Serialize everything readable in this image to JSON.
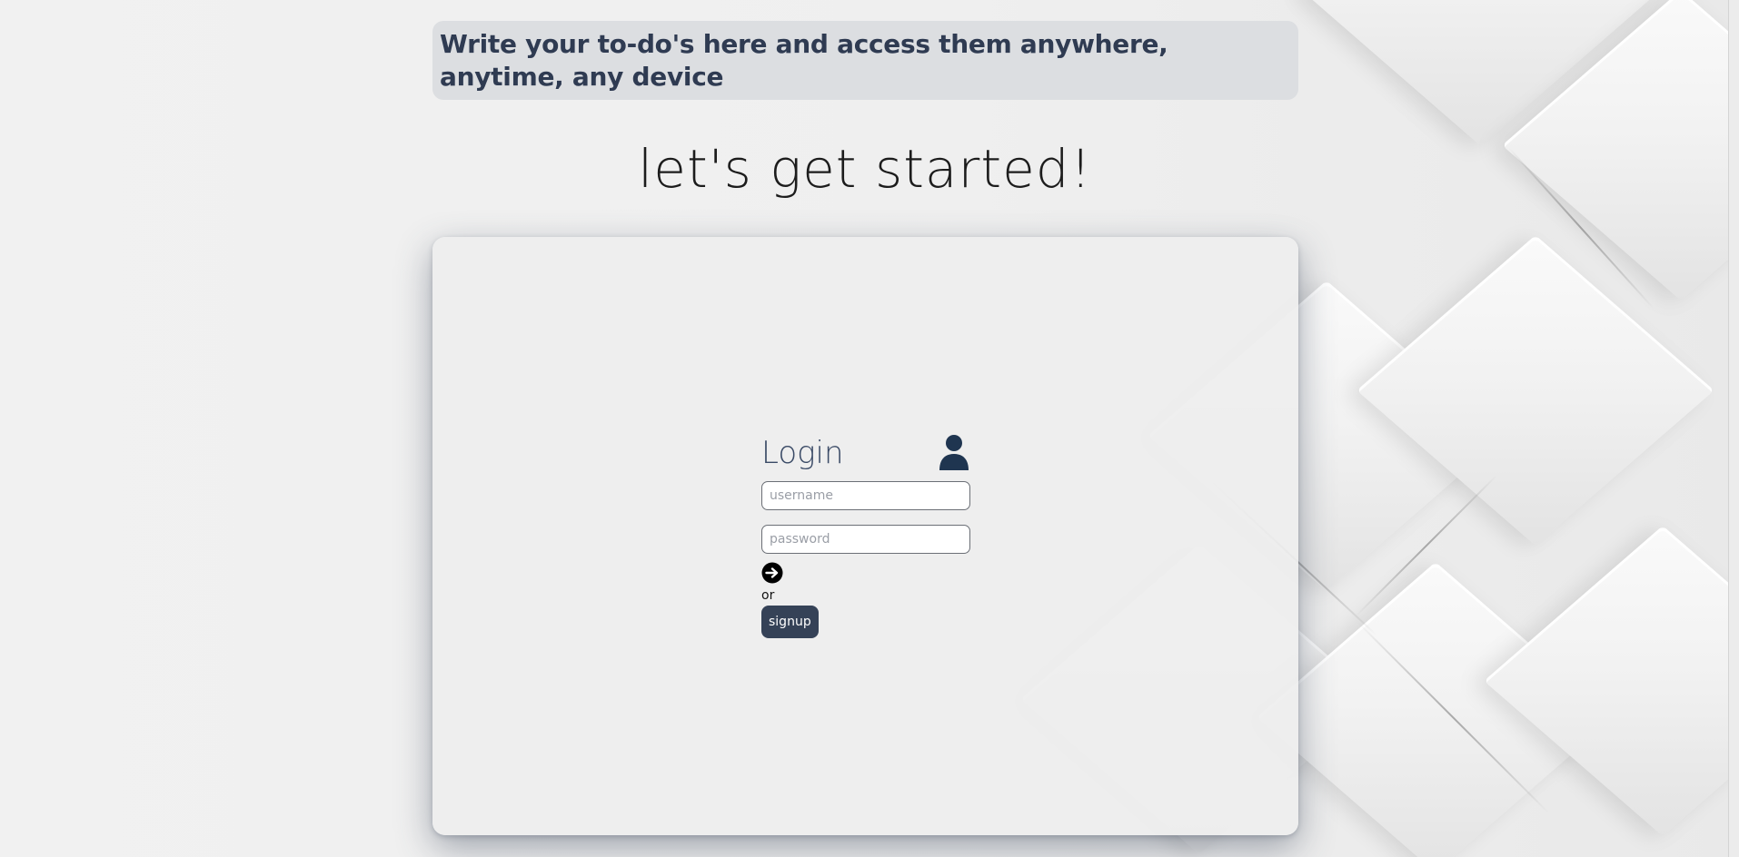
{
  "header": {
    "banner_text": "Write your to-do's here and access them anywhere, anytime, any device"
  },
  "hero": {
    "title": "let's get started!"
  },
  "login": {
    "title": "Login",
    "username_placeholder": "username",
    "password_placeholder": "password",
    "submit_icon": "arrow-right-circle-icon",
    "or_text": "or",
    "signup_label": "signup",
    "user_icon": "user-icon"
  },
  "colors": {
    "page_background": "#efefef",
    "banner_background": "#dcdee1",
    "banner_text": "#2f3b52",
    "login_title": "#3a4a66",
    "user_icon": "#1f3550",
    "signup_button": "#354257"
  }
}
